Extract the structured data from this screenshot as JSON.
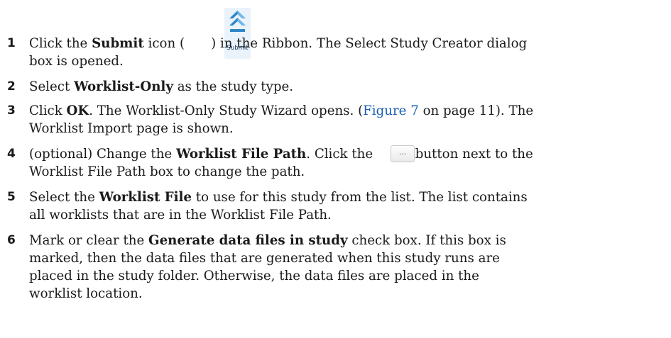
{
  "submit_icon": {
    "label": "Submit",
    "icon": "double-chevron-up-icon"
  },
  "ellipsis_button": {
    "label": "..."
  },
  "steps": [
    {
      "number": "1",
      "line1_a": "Click the ",
      "line1_b": "Submit",
      "line1_c": " icon (",
      "line1_d": ") in the Ribbon. The Select Study Creator dialog",
      "line2": "box is opened."
    },
    {
      "number": "2",
      "line1_a": "Select ",
      "line1_b": "Worklist-Only",
      "line1_c": " as the study type."
    },
    {
      "number": "3",
      "line1_a": "Click ",
      "line1_b": "OK",
      "line1_c": ". The Worklist-Only Study Wizard opens. (",
      "line1_link": "Figure 7",
      "line1_d": " on page 11). The",
      "line2": "Worklist Import page is shown."
    },
    {
      "number": "4",
      "line1_a": "(optional) Change the ",
      "line1_b": "Worklist File Path",
      "line1_c": ". Click the ",
      "line1_d": " button next to the",
      "line2": "Worklist File Path box to change the path."
    },
    {
      "number": "5",
      "line1_a": "Select the ",
      "line1_b": "Worklist File",
      "line1_c": " to use for this study from the list. The list contains",
      "line2": "all worklists that are in the Worklist File Path."
    },
    {
      "number": "6",
      "line1_a": "Mark or clear the ",
      "line1_b": "Generate data files in study",
      "line1_c": " check box. If this box is",
      "line2": "marked, then the data files that are generated when this study runs are",
      "line3": "placed in the study folder. Otherwise, the data files are placed in the",
      "line4": "worklist location."
    }
  ]
}
